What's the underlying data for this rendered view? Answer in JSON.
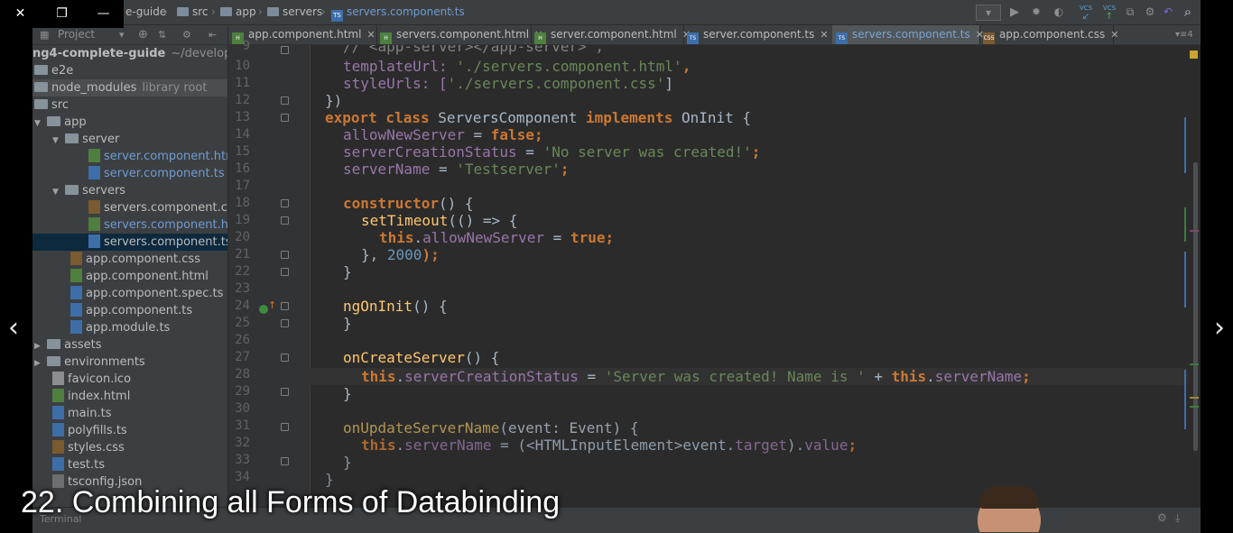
{
  "window_controls": {
    "close_glyph": "✕",
    "restore_glyph": "❐",
    "minimize_glyph": "—"
  },
  "breadcrumb": {
    "project": "e-guide",
    "items": [
      "src",
      "app",
      "servers"
    ],
    "file": "servers.component.ts"
  },
  "toolbar": {
    "run_config_glyph": "▾",
    "vcs1": "VCS",
    "vcs2": "VCS"
  },
  "project_tool": {
    "label": "Project"
  },
  "tabs": [
    {
      "label": "app.component.html",
      "type": "html"
    },
    {
      "label": "servers.component.html",
      "type": "html"
    },
    {
      "label": "server.component.html",
      "type": "html"
    },
    {
      "label": "server.component.ts",
      "type": "ts"
    },
    {
      "label": "servers.component.ts",
      "type": "ts",
      "active": true
    },
    {
      "label": "app.component.css",
      "type": "css"
    }
  ],
  "tabs_overflow": "4",
  "tree": {
    "root": "ng4-complete-guide",
    "root_path": "~/developme",
    "items": [
      {
        "label": "e2e"
      },
      {
        "label": "node_modules",
        "note": "library root"
      },
      {
        "label": "src"
      },
      {
        "label": "app"
      },
      {
        "label": "server"
      },
      {
        "label": "server.component.htm"
      },
      {
        "label": "server.component.ts"
      },
      {
        "label": "servers"
      },
      {
        "label": "servers.component.cs"
      },
      {
        "label": "servers.component.ht"
      },
      {
        "label": "servers.component.ts"
      },
      {
        "label": "app.component.css"
      },
      {
        "label": "app.component.html"
      },
      {
        "label": "app.component.spec.ts"
      },
      {
        "label": "app.component.ts"
      },
      {
        "label": "app.module.ts"
      },
      {
        "label": "assets"
      },
      {
        "label": "environments"
      },
      {
        "label": "favicon.ico"
      },
      {
        "label": "index.html"
      },
      {
        "label": "main.ts"
      },
      {
        "label": "polyfills.ts"
      },
      {
        "label": "styles.css"
      },
      {
        "label": "test.ts"
      },
      {
        "label": "tsconfig.json"
      }
    ]
  },
  "editor": {
    "line_numbers": [
      "10",
      "11",
      "12",
      "13",
      "14",
      "15",
      "16",
      "17",
      "18",
      "19",
      "20",
      "21",
      "22",
      "23",
      "24",
      "25",
      "26",
      "27",
      "28",
      "29",
      "30",
      "31",
      "32",
      "33",
      "34"
    ],
    "top_partial": "// <app-server></app-server>',",
    "lines": {
      "l10a": "templateUrl: ",
      "l10b": "'./servers.component.html'",
      "l10c": ",",
      "l11a": "styleUrls: [",
      "l11b": "'./servers.component.css'",
      "l11c": "]",
      "l12": "})",
      "l13a": "export class ",
      "l13b": "ServersComponent ",
      "l13c": "implements ",
      "l13d": "OnInit {",
      "l14a": "allowNewServer",
      "l14b": " = ",
      "l14c": "false",
      "l14d": ";",
      "l15a": "serverCreationStatus",
      "l15b": " = ",
      "l15c": "'No server was created!'",
      "l15d": ";",
      "l16a": "serverName",
      "l16b": " = ",
      "l16c": "'Testserver'",
      "l16d": ";",
      "l18a": "constructor",
      "l18b": "() {",
      "l19a": "setTimeout",
      "l19b": "(() => {",
      "l20a": "this",
      "l20b": ".",
      "l20c": "allowNewServer",
      "l20d": " = ",
      "l20e": "true",
      "l20f": ";",
      "l21a": "}, ",
      "l21b": "2000",
      "l21c": ");",
      "l22": "}",
      "l24a": "ngOnInit",
      "l24b": "() {",
      "l25": "}",
      "l27a": "onCreateServer",
      "l27b": "() {",
      "l28a": "this",
      "l28b": ".",
      "l28c": "serverCreationStatus",
      "l28d": " = ",
      "l28e": "'Server was created! Name is '",
      "l28f": " + ",
      "l28g": "this",
      "l28h": ".",
      "l28i": "serverName",
      "l28j": ";",
      "l29": "}",
      "l31a": "onUpdateServerName",
      "l31b": "(event: Event) {",
      "l32a": "this",
      "l32b": ".",
      "l32c": "serverName",
      "l32d": " = (<HTMLInputElement>event.",
      "l32e": "target",
      "l32f": ").",
      "l32g": "value",
      "l32h": ";",
      "l33": "}",
      "l34": "}"
    }
  },
  "bottom": {
    "label": "Terminal"
  },
  "lesson_title": "22. Combining all Forms of Databinding",
  "nav": {
    "prev": "‹",
    "next": "›"
  },
  "colors": {
    "keyword": "#cc7832",
    "string": "#6a8759",
    "field": "#9876aa",
    "function": "#ffc66d",
    "number": "#6897bb",
    "selection": "#0d293e"
  }
}
